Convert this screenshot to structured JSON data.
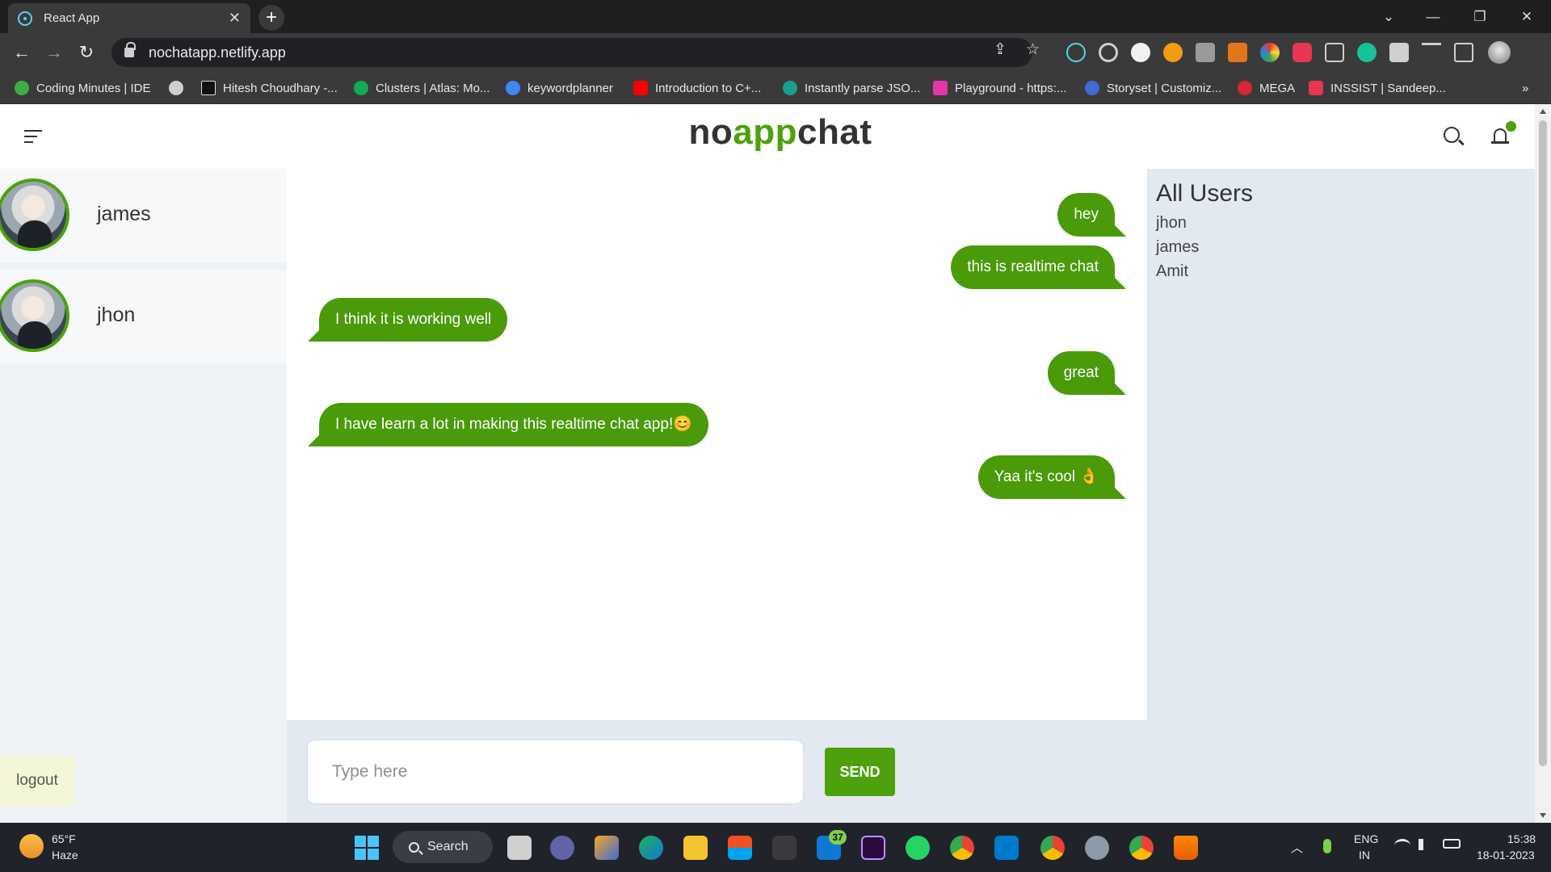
{
  "browser": {
    "tab_title": "React App",
    "tab_close": "✕",
    "new_tab": "+",
    "url": "nochatapp.netlify.app",
    "window_controls": {
      "dropdown": "⌄",
      "minimize": "—",
      "restore": "❐",
      "close": "✕"
    },
    "nav": {
      "back": "←",
      "forward": "→",
      "reload": "↻"
    },
    "omni_icons": {
      "share": "⇪",
      "star": "☆"
    },
    "bookmarks_more": "»",
    "bookmarks": [
      {
        "label": "Coding Minutes | IDE",
        "color": "#3cb043"
      },
      {
        "label": "",
        "color": "#cfcfcf"
      },
      {
        "label": "Hitesh Choudhary -...",
        "color": "#111111"
      },
      {
        "label": "Clusters | Atlas: Mo...",
        "color": "#13aa52"
      },
      {
        "label": "keywordplanner",
        "color": "#4285f4"
      },
      {
        "label": "Introduction to C+...",
        "color": "#ff0000"
      },
      {
        "label": "Instantly parse JSO...",
        "color": "#1a9e8f"
      },
      {
        "label": "Playground - https:...",
        "color": "#e535ab"
      },
      {
        "label": "Storyset | Customiz...",
        "color": "#3f6ad8"
      },
      {
        "label": "MEGA",
        "color": "#d9272e"
      },
      {
        "label": "INSSIST | Sandeep...",
        "color": "#e8364f"
      }
    ]
  },
  "app": {
    "logo": {
      "part1": "no",
      "part2": "app",
      "part3": "chat"
    },
    "accent_color": "#4ca10d",
    "contacts": [
      {
        "name": "james"
      },
      {
        "name": "jhon"
      }
    ],
    "logout_label": "logout",
    "messages": [
      {
        "text": "hey",
        "side": "right"
      },
      {
        "text": "this is realtime chat",
        "side": "right"
      },
      {
        "text": "I think it is working well",
        "side": "left"
      },
      {
        "text": "great",
        "side": "right"
      },
      {
        "text": "I have learn a lot in making this realtime chat app!😊",
        "side": "left"
      },
      {
        "text": "Yaa it's cool 👌",
        "side": "right"
      }
    ],
    "input_placeholder": "Type here",
    "send_label": "SEND",
    "users_panel": {
      "title": "All Users",
      "users": [
        "jhon",
        "james",
        "Amit"
      ]
    }
  },
  "taskbar": {
    "temperature": "65°F",
    "weather": "Haze",
    "search_label": "Search",
    "mail_badge": "37",
    "language_1": "ENG",
    "language_2": "IN",
    "time": "15:38",
    "date": "18-01-2023",
    "tray_up": "︿"
  }
}
